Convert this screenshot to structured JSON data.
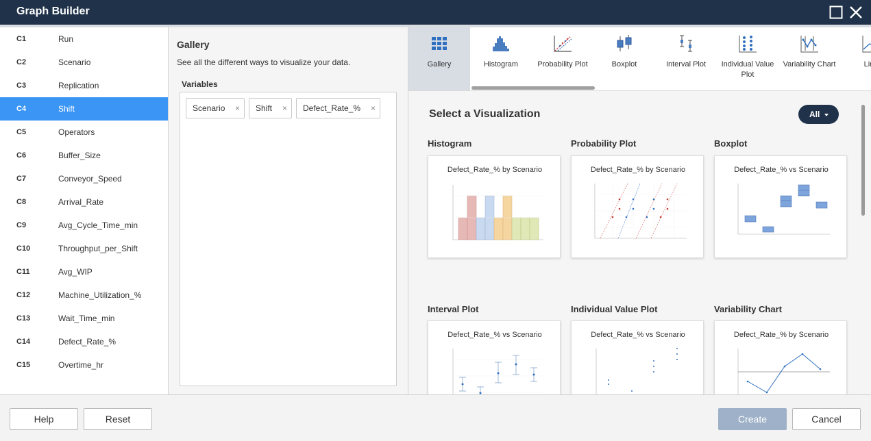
{
  "window": {
    "title": "Graph Builder",
    "maximize_icon": "maximize-icon",
    "close_icon": "close-icon"
  },
  "columns": [
    {
      "id": "C1",
      "name": "Run"
    },
    {
      "id": "C2",
      "name": "Scenario"
    },
    {
      "id": "C3",
      "name": "Replication"
    },
    {
      "id": "C4",
      "name": "Shift",
      "selected": true
    },
    {
      "id": "C5",
      "name": "Operators"
    },
    {
      "id": "C6",
      "name": "Buffer_Size"
    },
    {
      "id": "C7",
      "name": "Conveyor_Speed"
    },
    {
      "id": "C8",
      "name": "Arrival_Rate"
    },
    {
      "id": "C9",
      "name": "Avg_Cycle_Time_min"
    },
    {
      "id": "C10",
      "name": "Throughput_per_Shift"
    },
    {
      "id": "C11",
      "name": "Avg_WIP"
    },
    {
      "id": "C12",
      "name": "Machine_Utilization_%"
    },
    {
      "id": "C13",
      "name": "Wait_Time_min"
    },
    {
      "id": "C14",
      "name": "Defect_Rate_%"
    },
    {
      "id": "C15",
      "name": "Overtime_hr"
    }
  ],
  "gallery_panel": {
    "title": "Gallery",
    "description": "See all the different ways to visualize your data.",
    "variables_label": "Variables",
    "variables": [
      {
        "label": "Scenario",
        "remove": "×"
      },
      {
        "label": "Shift",
        "remove": "×"
      },
      {
        "label": "Defect_Rate_%",
        "remove": "×"
      }
    ]
  },
  "tabs": [
    {
      "label": "Gallery",
      "icon": "grid-icon",
      "active": true
    },
    {
      "label": "Histogram",
      "icon": "histogram-icon"
    },
    {
      "label": "Probability Plot",
      "icon": "probability-plot-icon"
    },
    {
      "label": "Boxplot",
      "icon": "boxplot-icon"
    },
    {
      "label": "Interval Plot",
      "icon": "interval-plot-icon"
    },
    {
      "label": "Individual Value Plot",
      "icon": "individual-value-plot-icon"
    },
    {
      "label": "Variability Chart",
      "icon": "variability-chart-icon"
    },
    {
      "label": "Line",
      "icon": "line-chart-icon"
    }
  ],
  "visualizations": {
    "title": "Select a Visualization",
    "filter_label": "All",
    "cards": [
      {
        "label": "Histogram",
        "title": "Defect_Rate_% by Scenario"
      },
      {
        "label": "Probability Plot",
        "title": "Defect_Rate_% by Scenario"
      },
      {
        "label": "Boxplot",
        "title": "Defect_Rate_% vs Scenario"
      },
      {
        "label": "Interval Plot",
        "title": "Defect_Rate_% vs Scenario"
      },
      {
        "label": "Individual Value Plot",
        "title": "Defect_Rate_% vs Scenario"
      },
      {
        "label": "Variability Chart",
        "title": "Defect_Rate_% by Scenario"
      }
    ]
  },
  "footer": {
    "help": "Help",
    "reset": "Reset",
    "create": "Create",
    "cancel": "Cancel"
  }
}
